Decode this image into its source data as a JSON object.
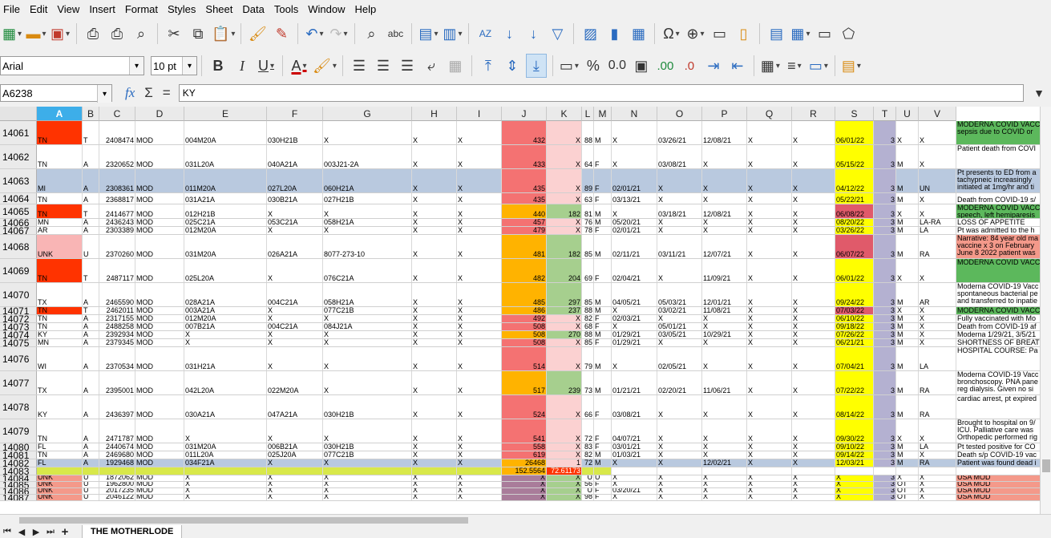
{
  "menu": [
    "File",
    "Edit",
    "View",
    "Insert",
    "Format",
    "Styles",
    "Sheet",
    "Data",
    "Tools",
    "Window",
    "Help"
  ],
  "toolbar": {
    "font_name": "Arial",
    "font_size": "10 pt",
    "bold": "B",
    "italic": "I",
    "underline": "U",
    "font_color_label": "A",
    "percent": "%",
    "number_format": "0.0",
    "add_decimal": ".00",
    "del_decimal": ".0"
  },
  "formula_bar": {
    "cell_ref": "A6238",
    "fx": "fx",
    "sigma": "Σ",
    "equals": "=",
    "content": "KY"
  },
  "colors": {
    "red_dark": "#ff3300",
    "red_med": "#f47272",
    "red_light": "#f9b5b5",
    "pink": "#fbd1d1",
    "orange": "#ffb300",
    "green": "#a6cf8e",
    "green_bright": "#5cb85c",
    "yellow": "#ffff00",
    "lavender": "#b4b1d1",
    "blue_row": "#b9c9df",
    "salmon": "#f4998a",
    "mauve": "#a97c9a",
    "lime": "#d8e84a",
    "rose": "#e05a6a"
  },
  "sheet": {
    "columns": [
      "A",
      "B",
      "C",
      "D",
      "E",
      "F",
      "G",
      "H",
      "I",
      "J",
      "K",
      "L",
      "M",
      "N",
      "O",
      "P",
      "Q",
      "R",
      "S",
      "T",
      "U",
      "V"
    ],
    "selected_column": "A",
    "rows": [
      {
        "h": 30,
        "n": "14061",
        "bgA": "red_dark",
        "c": [
          "TN",
          "T",
          "2408474",
          "MOD",
          "004M20A",
          "030H21B",
          "X",
          "X",
          "X",
          "432",
          "X",
          "88",
          "M",
          "X",
          "03/26/21",
          "12/08/21",
          "X",
          "X",
          "06/01/22",
          "3",
          "X",
          "X",
          "MODERNA COVID VACC\nsepsis due to COVID or"
        ],
        "wfill": "green_bright",
        "jf": "red_med",
        "kf": "pink"
      },
      {
        "h": 30,
        "n": "14062",
        "c": [
          "TN",
          "A",
          "2320652",
          "MOD",
          "031L20A",
          "040A21A",
          "003J21-2A",
          "X",
          "X",
          "433",
          "X",
          "64",
          "F",
          "X",
          "03/08/21",
          "X",
          "X",
          "X",
          "05/15/22",
          "3",
          "M",
          "X",
          "Patient death from COVI"
        ],
        "jf": "red_med",
        "kf": "pink"
      },
      {
        "h": 30,
        "n": "14063",
        "rowfill": "blue_row",
        "c": [
          "MI",
          "A",
          "2308361",
          "MOD",
          "011M20A",
          "027L20A",
          "060H21A",
          "X",
          "X",
          "435",
          "X",
          "89",
          "F",
          "02/01/21",
          "X",
          "X",
          "X",
          "X",
          "04/12/22",
          "3",
          "M",
          "UN",
          "Pt presents to ED from a\ntachypneic increasingly\ninitiated at 1mg/hr and ti"
        ],
        "jf": "red_med",
        "kf": "pink"
      },
      {
        "h": 14,
        "n": "14064",
        "c": [
          "TN",
          "A",
          "2368817",
          "MOD",
          "031A21A",
          "030B21A",
          "027H21B",
          "X",
          "X",
          "435",
          "X",
          "63",
          "F",
          "03/13/21",
          "X",
          "X",
          "X",
          "X",
          "05/22/21",
          "3",
          "M",
          "X",
          "Death from COVID-19 s/"
        ],
        "jf": "red_med",
        "kf": "pink"
      },
      {
        "h": 18,
        "n": "14065",
        "bgA": "red_dark",
        "c": [
          "TN",
          "T",
          "2414677",
          "MOD",
          "012H21B",
          "X",
          "X",
          "X",
          "X",
          "440",
          "182",
          "81",
          "M",
          "X",
          "03/18/21",
          "12/08/21",
          "X",
          "X",
          "06/08/22",
          "3",
          "X",
          "X",
          "MODERNA COVID VACC\nspeech, left hemiparesis"
        ],
        "wfill": "green_bright",
        "jf": "orange",
        "kf": "green",
        "sf": "rose"
      },
      {
        "h": 10,
        "n": "14066",
        "c": [
          "MN",
          "A",
          "2436243",
          "MOD",
          "025C21A",
          "053C21A",
          "058H21A",
          "X",
          "X",
          "457",
          "X",
          "76",
          "M",
          "05/20/21",
          "X",
          "X",
          "X",
          "X",
          "08/20/22",
          "3",
          "M",
          "LA-RA",
          "LOSS OF APPETITE"
        ],
        "jf": "red_med",
        "kf": "pink"
      },
      {
        "h": 10,
        "n": "14067",
        "c": [
          "AR",
          "A",
          "2303389",
          "MOD",
          "012M20A",
          "X",
          "X",
          "X",
          "X",
          "479",
          "X",
          "78",
          "F",
          "02/01/21",
          "X",
          "X",
          "X",
          "X",
          "03/26/22",
          "3",
          "M",
          "LA",
          "Pt was admitted to the h"
        ],
        "jf": "red_med",
        "kf": "pink"
      },
      {
        "h": 30,
        "n": "14068",
        "bgA": "red_light",
        "c": [
          "UNK",
          "U",
          "2370260",
          "MOD",
          "031M20A",
          "026A21A",
          "8077-273-10",
          "X",
          "X",
          "481",
          "182",
          "85",
          "M",
          "02/11/21",
          "03/11/21",
          "12/07/21",
          "X",
          "X",
          "06/07/22",
          "3",
          "M",
          "RA",
          "Narrative: 84 year old ma\nvaccine x 3 on February\nJune 8 2022 patient was"
        ],
        "wfill": "salmon",
        "jf": "orange",
        "kf": "green",
        "sf": "rose"
      },
      {
        "h": 30,
        "n": "14069",
        "bgA": "red_dark",
        "c": [
          "TN",
          "T",
          "2487117",
          "MOD",
          "025L20A",
          "X",
          "076C21A",
          "X",
          "X",
          "482",
          "204",
          "69",
          "F",
          "02/04/21",
          "X",
          "11/09/21",
          "X",
          "X",
          "06/01/22",
          "3",
          "X",
          "X",
          "MODERNA COVID VACC"
        ],
        "wfill": "green_bright",
        "jf": "orange",
        "kf": "green"
      },
      {
        "h": 30,
        "n": "14070",
        "c": [
          "TX",
          "A",
          "2465590",
          "MOD",
          "028A21A",
          "004C21A",
          "058H21A",
          "X",
          "X",
          "485",
          "297",
          "85",
          "M",
          "04/05/21",
          "05/03/21",
          "12/01/21",
          "X",
          "X",
          "09/24/22",
          "3",
          "M",
          "AR",
          "Moderna COVID-19 Vacc\nspontaneous bacterial pe\nand transferred to inpatie"
        ],
        "jf": "orange",
        "kf": "green"
      },
      {
        "h": 10,
        "n": "14071",
        "bgA": "red_dark",
        "c": [
          "TN",
          "T",
          "2462011",
          "MOD",
          "003A21A",
          "X",
          "077C21B",
          "X",
          "X",
          "486",
          "237",
          "88",
          "M",
          "X",
          "03/02/21",
          "11/08/21",
          "X",
          "X",
          "07/03/22",
          "3",
          "X",
          "X",
          "MODERNA COVID VACC"
        ],
        "wfill": "green_bright",
        "jf": "orange",
        "kf": "green",
        "sf": "rose"
      },
      {
        "h": 10,
        "n": "14072",
        "c": [
          "TN",
          "A",
          "2317155",
          "MOD",
          "012M20A",
          "X",
          "X",
          "X",
          "X",
          "492",
          "X",
          "82",
          "F",
          "02/03/21",
          "X",
          "X",
          "X",
          "X",
          "06/10/22",
          "3",
          "M",
          "X",
          "Fully vaccinated with Mo"
        ],
        "jf": "red_med",
        "kf": "pink"
      },
      {
        "h": 10,
        "n": "14073",
        "c": [
          "TN",
          "A",
          "2488258",
          "MOD",
          "007B21A",
          "004C21A",
          "084J21A",
          "X",
          "X",
          "508",
          "X",
          "68",
          "F",
          "X",
          "05/01/21",
          "X",
          "X",
          "X",
          "09/18/22",
          "3",
          "M",
          "X",
          "Death from COVID-19 af"
        ],
        "jf": "red_med",
        "kf": "pink"
      },
      {
        "h": 10,
        "n": "14074",
        "c": [
          "KY",
          "A",
          "2392934",
          "MOD",
          "X",
          "X",
          "X",
          "X",
          "X",
          "508",
          "270",
          "88",
          "M",
          "01/29/21",
          "03/05/21",
          "10/29/21",
          "X",
          "X",
          "07/26/22",
          "3",
          "M",
          "X",
          "Moderna 1/29/21, 3/5/21"
        ],
        "jf": "orange",
        "kf": "green"
      },
      {
        "h": 10,
        "n": "14075",
        "c": [
          "MN",
          "A",
          "2379345",
          "MOD",
          "X",
          "X",
          "X",
          "X",
          "X",
          "508",
          "X",
          "85",
          "F",
          "01/29/21",
          "X",
          "X",
          "X",
          "X",
          "06/21/21",
          "3",
          "M",
          "X",
          "SHORTNESS OF BREAT"
        ],
        "jf": "red_med",
        "kf": "pink"
      },
      {
        "h": 30,
        "n": "14076",
        "c": [
          "WI",
          "A",
          "2370534",
          "MOD",
          "031H21A",
          "X",
          "X",
          "X",
          "X",
          "514",
          "X",
          "79",
          "M",
          "X",
          "02/05/21",
          "X",
          "X",
          "X",
          "07/04/21",
          "3",
          "M",
          "LA",
          "HOSPITAL COURSE: Pa"
        ],
        "jf": "red_med",
        "kf": "pink"
      },
      {
        "h": 30,
        "n": "14077",
        "c": [
          "TX",
          "A",
          "2395001",
          "MOD",
          "042L20A",
          "022M20A",
          "X",
          "X",
          "X",
          "517",
          "239",
          "73",
          "M",
          "01/21/21",
          "02/20/21",
          "11/06/21",
          "X",
          "X",
          "07/22/22",
          "3",
          "M",
          "RA",
          "Moderna COVID-19 Vacc\nbronchoscopy. PNA pane\nreg dialysis. Given no si"
        ],
        "jf": "orange",
        "kf": "green"
      },
      {
        "h": 30,
        "n": "14078",
        "c": [
          "KY",
          "A",
          "2436397",
          "MOD",
          "030A21A",
          "047A21A",
          "030H21B",
          "X",
          "X",
          "524",
          "X",
          "66",
          "F",
          "03/08/21",
          "X",
          "X",
          "X",
          "X",
          "08/14/22",
          "3",
          "M",
          "RA",
          "cardiac arrest, pt expired"
        ],
        "jf": "red_med",
        "kf": "pink"
      },
      {
        "h": 30,
        "n": "14079",
        "c": [
          "TN",
          "A",
          "2471787",
          "MOD",
          "X",
          "X",
          "X",
          "X",
          "X",
          "541",
          "X",
          "72",
          "F",
          "04/07/21",
          "X",
          "X",
          "X",
          "X",
          "09/30/22",
          "3",
          "X",
          "X",
          "Brought to hospital on 9/\nICU. Palliative care was\nOrthopedic performed rig"
        ],
        "jf": "red_med",
        "kf": "pink"
      },
      {
        "h": 10,
        "n": "14080",
        "c": [
          "FL",
          "A",
          "2440674",
          "MOD",
          "031M20A",
          "006B21A",
          "030H21B",
          "X",
          "X",
          "558",
          "X",
          "83",
          "F",
          "03/01/21",
          "X",
          "X",
          "X",
          "X",
          "09/10/22",
          "3",
          "M",
          "LA",
          "Pt tested positive for CO"
        ],
        "jf": "red_med",
        "kf": "pink"
      },
      {
        "h": 10,
        "n": "14081",
        "c": [
          "TN",
          "A",
          "2469680",
          "MOD",
          "011L20A",
          "025J20A",
          "077C21B",
          "X",
          "X",
          "619",
          "X",
          "82",
          "M",
          "01/03/21",
          "X",
          "X",
          "X",
          "X",
          "09/14/22",
          "3",
          "M",
          "X",
          "Death s/p COVID-19 vac"
        ],
        "jf": "red_med",
        "kf": "pink"
      },
      {
        "h": 10,
        "n": "14082",
        "rowfill": "blue_row",
        "c": [
          "FL",
          "A",
          "1929468",
          "MOD",
          "034F21A",
          "X",
          "X",
          "X",
          "X",
          "26468",
          "1",
          "72",
          "M",
          "X",
          "X",
          "12/02/21",
          "X",
          "X",
          "12/03/21",
          "3",
          "M",
          "RA",
          "Patient was found dead i"
        ],
        "jf": "orange",
        "kf": "pink"
      },
      {
        "h": 10,
        "n": "14083",
        "rowfill": "lime",
        "c": [
          "",
          "",
          "",
          "",
          "",
          "",
          "",
          "",
          "",
          "152.5564",
          "72.61173",
          "",
          "",
          "",
          "",
          "",
          "",
          "",
          "",
          "",
          "",
          "",
          ""
        ],
        "jf": "orange",
        "kf": "red_dark"
      },
      {
        "h": 8,
        "n": "14084",
        "bgA": "salmon",
        "c": [
          "UNK",
          "U",
          "1872062",
          "MOD",
          "X",
          "X",
          "X",
          "X",
          "X",
          "X",
          "X",
          "U",
          "U",
          "X",
          "X",
          "X",
          "X",
          "X",
          "X",
          "3",
          "X",
          "X",
          "USA MOD"
        ],
        "wfill": "salmon",
        "jf": "mauve",
        "kf": "green"
      },
      {
        "h": 8,
        "n": "14085",
        "bgA": "salmon",
        "c": [
          "UNK",
          "U",
          "1962800",
          "MOD",
          "X",
          "X",
          "X",
          "X",
          "X",
          "X",
          "X",
          "56",
          "F",
          "X",
          "X",
          "X",
          "X",
          "X",
          "X",
          "3",
          "OT",
          "X",
          "USA MOD"
        ],
        "wfill": "salmon",
        "jf": "mauve",
        "kf": "green"
      },
      {
        "h": 8,
        "n": "14086",
        "bgA": "salmon",
        "c": [
          "UNK",
          "U",
          "2017235",
          "MOD",
          "X",
          "X",
          "X",
          "X",
          "X",
          "X",
          "X",
          "U",
          "F",
          "03/20/21",
          "X",
          "X",
          "X",
          "X",
          "X",
          "3",
          "OT",
          "X",
          "USA MOD"
        ],
        "wfill": "salmon",
        "jf": "mauve",
        "kf": "green"
      },
      {
        "h": 8,
        "n": "14087",
        "bgA": "salmon",
        "c": [
          "UNK",
          "U",
          "2046122",
          "MOD",
          "X",
          "X",
          "X",
          "X",
          "X",
          "X",
          "X",
          "98",
          "F",
          "X",
          "X",
          "X",
          "X",
          "X",
          "X",
          "3",
          "OT",
          "X",
          "USA MOD"
        ],
        "wfill": "salmon",
        "jf": "mauve",
        "kf": "green"
      }
    ]
  },
  "sheet_tab": "THE MOTHERLODE"
}
